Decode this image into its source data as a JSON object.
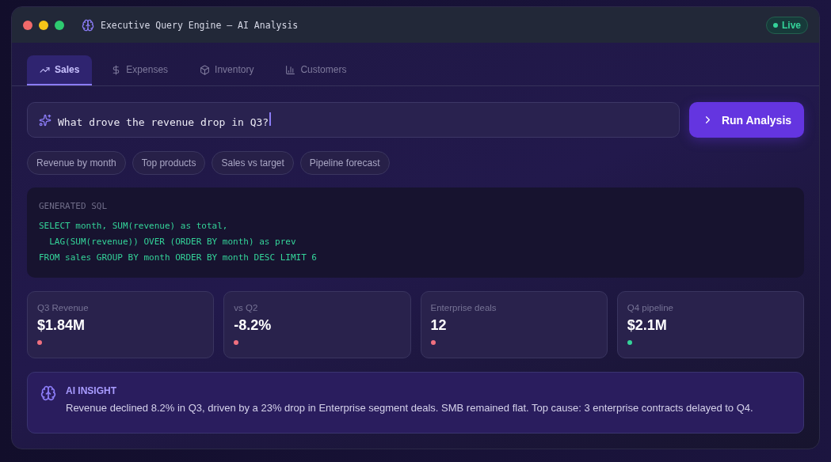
{
  "window": {
    "title": "Executive Query Engine — AI Analysis",
    "status": "Live"
  },
  "tabs": [
    {
      "label": "Sales",
      "selected": true
    },
    {
      "label": "Expenses",
      "selected": false
    },
    {
      "label": "Inventory",
      "selected": false
    },
    {
      "label": "Customers",
      "selected": false
    }
  ],
  "query": {
    "value": "What drove the revenue drop in Q3?"
  },
  "run_button": "Run Analysis",
  "suggestions": [
    "Revenue by month",
    "Top products",
    "Sales vs target",
    "Pipeline forecast"
  ],
  "sql": {
    "heading": "GENERATED SQL",
    "lines": [
      "SELECT month, SUM(revenue) as total,",
      "  LAG(SUM(revenue)) OVER (ORDER BY month) as prev",
      "FROM sales GROUP BY month ORDER BY month DESC LIMIT 6"
    ]
  },
  "metrics": [
    {
      "label": "Q3 Revenue",
      "value": "$1.84M",
      "color": "#f0707f"
    },
    {
      "label": "vs Q2",
      "value": "-8.2%",
      "color": "#f0707f"
    },
    {
      "label": "Enterprise deals",
      "value": "12",
      "color": "#f0707f"
    },
    {
      "label": "Q4 pipeline",
      "value": "$2.1M",
      "color": "#34d399"
    }
  ],
  "insight": {
    "heading": "AI INSIGHT",
    "text": "Revenue declined 8.2% in Q3, driven by a 23% drop in Enterprise segment deals. SMB remained flat. Top cause: 3 enterprise contracts delayed to Q4."
  }
}
